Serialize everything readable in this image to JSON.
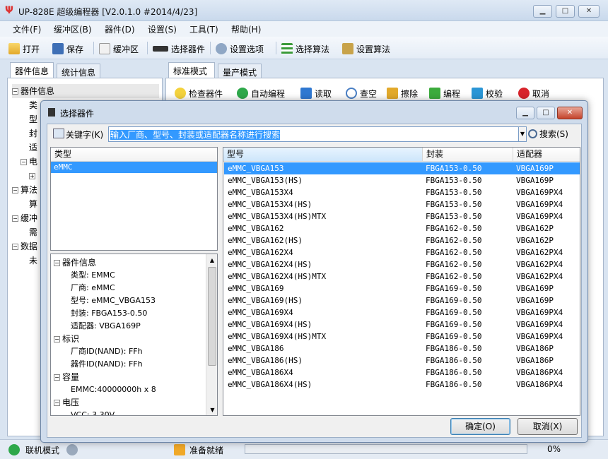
{
  "window": {
    "title": "UP-828E 超级编程器  [V2.0.1.0 #2014/4/23]"
  },
  "menu": [
    "文件(F)",
    "缓冲区(B)",
    "器件(D)",
    "设置(S)",
    "工具(T)",
    "帮助(H)"
  ],
  "toolbar": {
    "open": "打开",
    "save": "保存",
    "buffer": "缓冲区",
    "select_device": "选择器件",
    "settings": "设置选项",
    "select_algo": "选择算法",
    "set_algo": "设置算法"
  },
  "left_tabs": {
    "device_info": "器件信息",
    "stats": "统计信息"
  },
  "left_tree": [
    "器件信息",
    "类",
    "型",
    "封",
    "适",
    "电",
    "",
    "算法",
    "算",
    "缓冲",
    "需",
    "数据",
    "未"
  ],
  "right_tabs": {
    "standard": "标准模式",
    "production": "量产模式"
  },
  "ops": {
    "check": "检查器件",
    "auto": "自动编程",
    "read": "读取",
    "blank": "查空",
    "erase": "擦除",
    "program": "编程",
    "verify": "校验",
    "cancel": "取消"
  },
  "status": {
    "mode": "联机模式",
    "ready": "准备就绪",
    "percent": "0%"
  },
  "dialog": {
    "title": "选择器件",
    "keyword_label": "关键字(K)",
    "search_text": "输入厂商、型号、封装或适配器名称进行搜索",
    "search_button": "搜索(S)",
    "type_header": "类型",
    "types": [
      "eMMC"
    ],
    "columns": {
      "model": "型号",
      "package": "封装",
      "adapter": "适配器"
    },
    "devices": [
      [
        "eMMC_VBGA153",
        "FBGA153-0.50",
        "VBGA169P"
      ],
      [
        "eMMC_VBGA153(HS)",
        "FBGA153-0.50",
        "VBGA169P"
      ],
      [
        "eMMC_VBGA153X4",
        "FBGA153-0.50",
        "VBGA169PX4"
      ],
      [
        "eMMC_VBGA153X4(HS)",
        "FBGA153-0.50",
        "VBGA169PX4"
      ],
      [
        "eMMC_VBGA153X4(HS)MTX",
        "FBGA153-0.50",
        "VBGA169PX4"
      ],
      [
        "eMMC_VBGA162",
        "FBGA162-0.50",
        "VBGA162P"
      ],
      [
        "eMMC_VBGA162(HS)",
        "FBGA162-0.50",
        "VBGA162P"
      ],
      [
        "eMMC_VBGA162X4",
        "FBGA162-0.50",
        "VBGA162PX4"
      ],
      [
        "eMMC_VBGA162X4(HS)",
        "FBGA162-0.50",
        "VBGA162PX4"
      ],
      [
        "eMMC_VBGA162X4(HS)MTX",
        "FBGA162-0.50",
        "VBGA162PX4"
      ],
      [
        "eMMC_VBGA169",
        "FBGA169-0.50",
        "VBGA169P"
      ],
      [
        "eMMC_VBGA169(HS)",
        "FBGA169-0.50",
        "VBGA169P"
      ],
      [
        "eMMC_VBGA169X4",
        "FBGA169-0.50",
        "VBGA169PX4"
      ],
      [
        "eMMC_VBGA169X4(HS)",
        "FBGA169-0.50",
        "VBGA169PX4"
      ],
      [
        "eMMC_VBGA169X4(HS)MTX",
        "FBGA169-0.50",
        "VBGA169PX4"
      ],
      [
        "eMMC_VBGA186",
        "FBGA186-0.50",
        "VBGA186P"
      ],
      [
        "eMMC_VBGA186(HS)",
        "FBGA186-0.50",
        "VBGA186P"
      ],
      [
        "eMMC_VBGA186X4",
        "FBGA186-0.50",
        "VBGA186PX4"
      ],
      [
        "eMMC_VBGA186X4(HS)",
        "FBGA186-0.50",
        "VBGA186PX4"
      ]
    ],
    "info": [
      {
        "kind": "group",
        "text": "器件信息"
      },
      {
        "kind": "item",
        "text": "类型: EMMC"
      },
      {
        "kind": "item",
        "text": "厂商: eMMC"
      },
      {
        "kind": "item",
        "text": "型号: eMMC_VBGA153"
      },
      {
        "kind": "item",
        "text": "封装: FBGA153-0.50"
      },
      {
        "kind": "item",
        "text": "适配器: VBGA169P"
      },
      {
        "kind": "group",
        "text": "标识"
      },
      {
        "kind": "item",
        "text": "厂商ID(NAND): FFh"
      },
      {
        "kind": "item",
        "text": "器件ID(NAND): FFh"
      },
      {
        "kind": "group",
        "text": "容量"
      },
      {
        "kind": "item",
        "text": "EMMC:40000000h x 8"
      },
      {
        "kind": "group",
        "text": "电压"
      },
      {
        "kind": "item",
        "text": "VCC: 3.30V"
      }
    ],
    "ok": "确定(O)",
    "cancel": "取消(X)"
  }
}
